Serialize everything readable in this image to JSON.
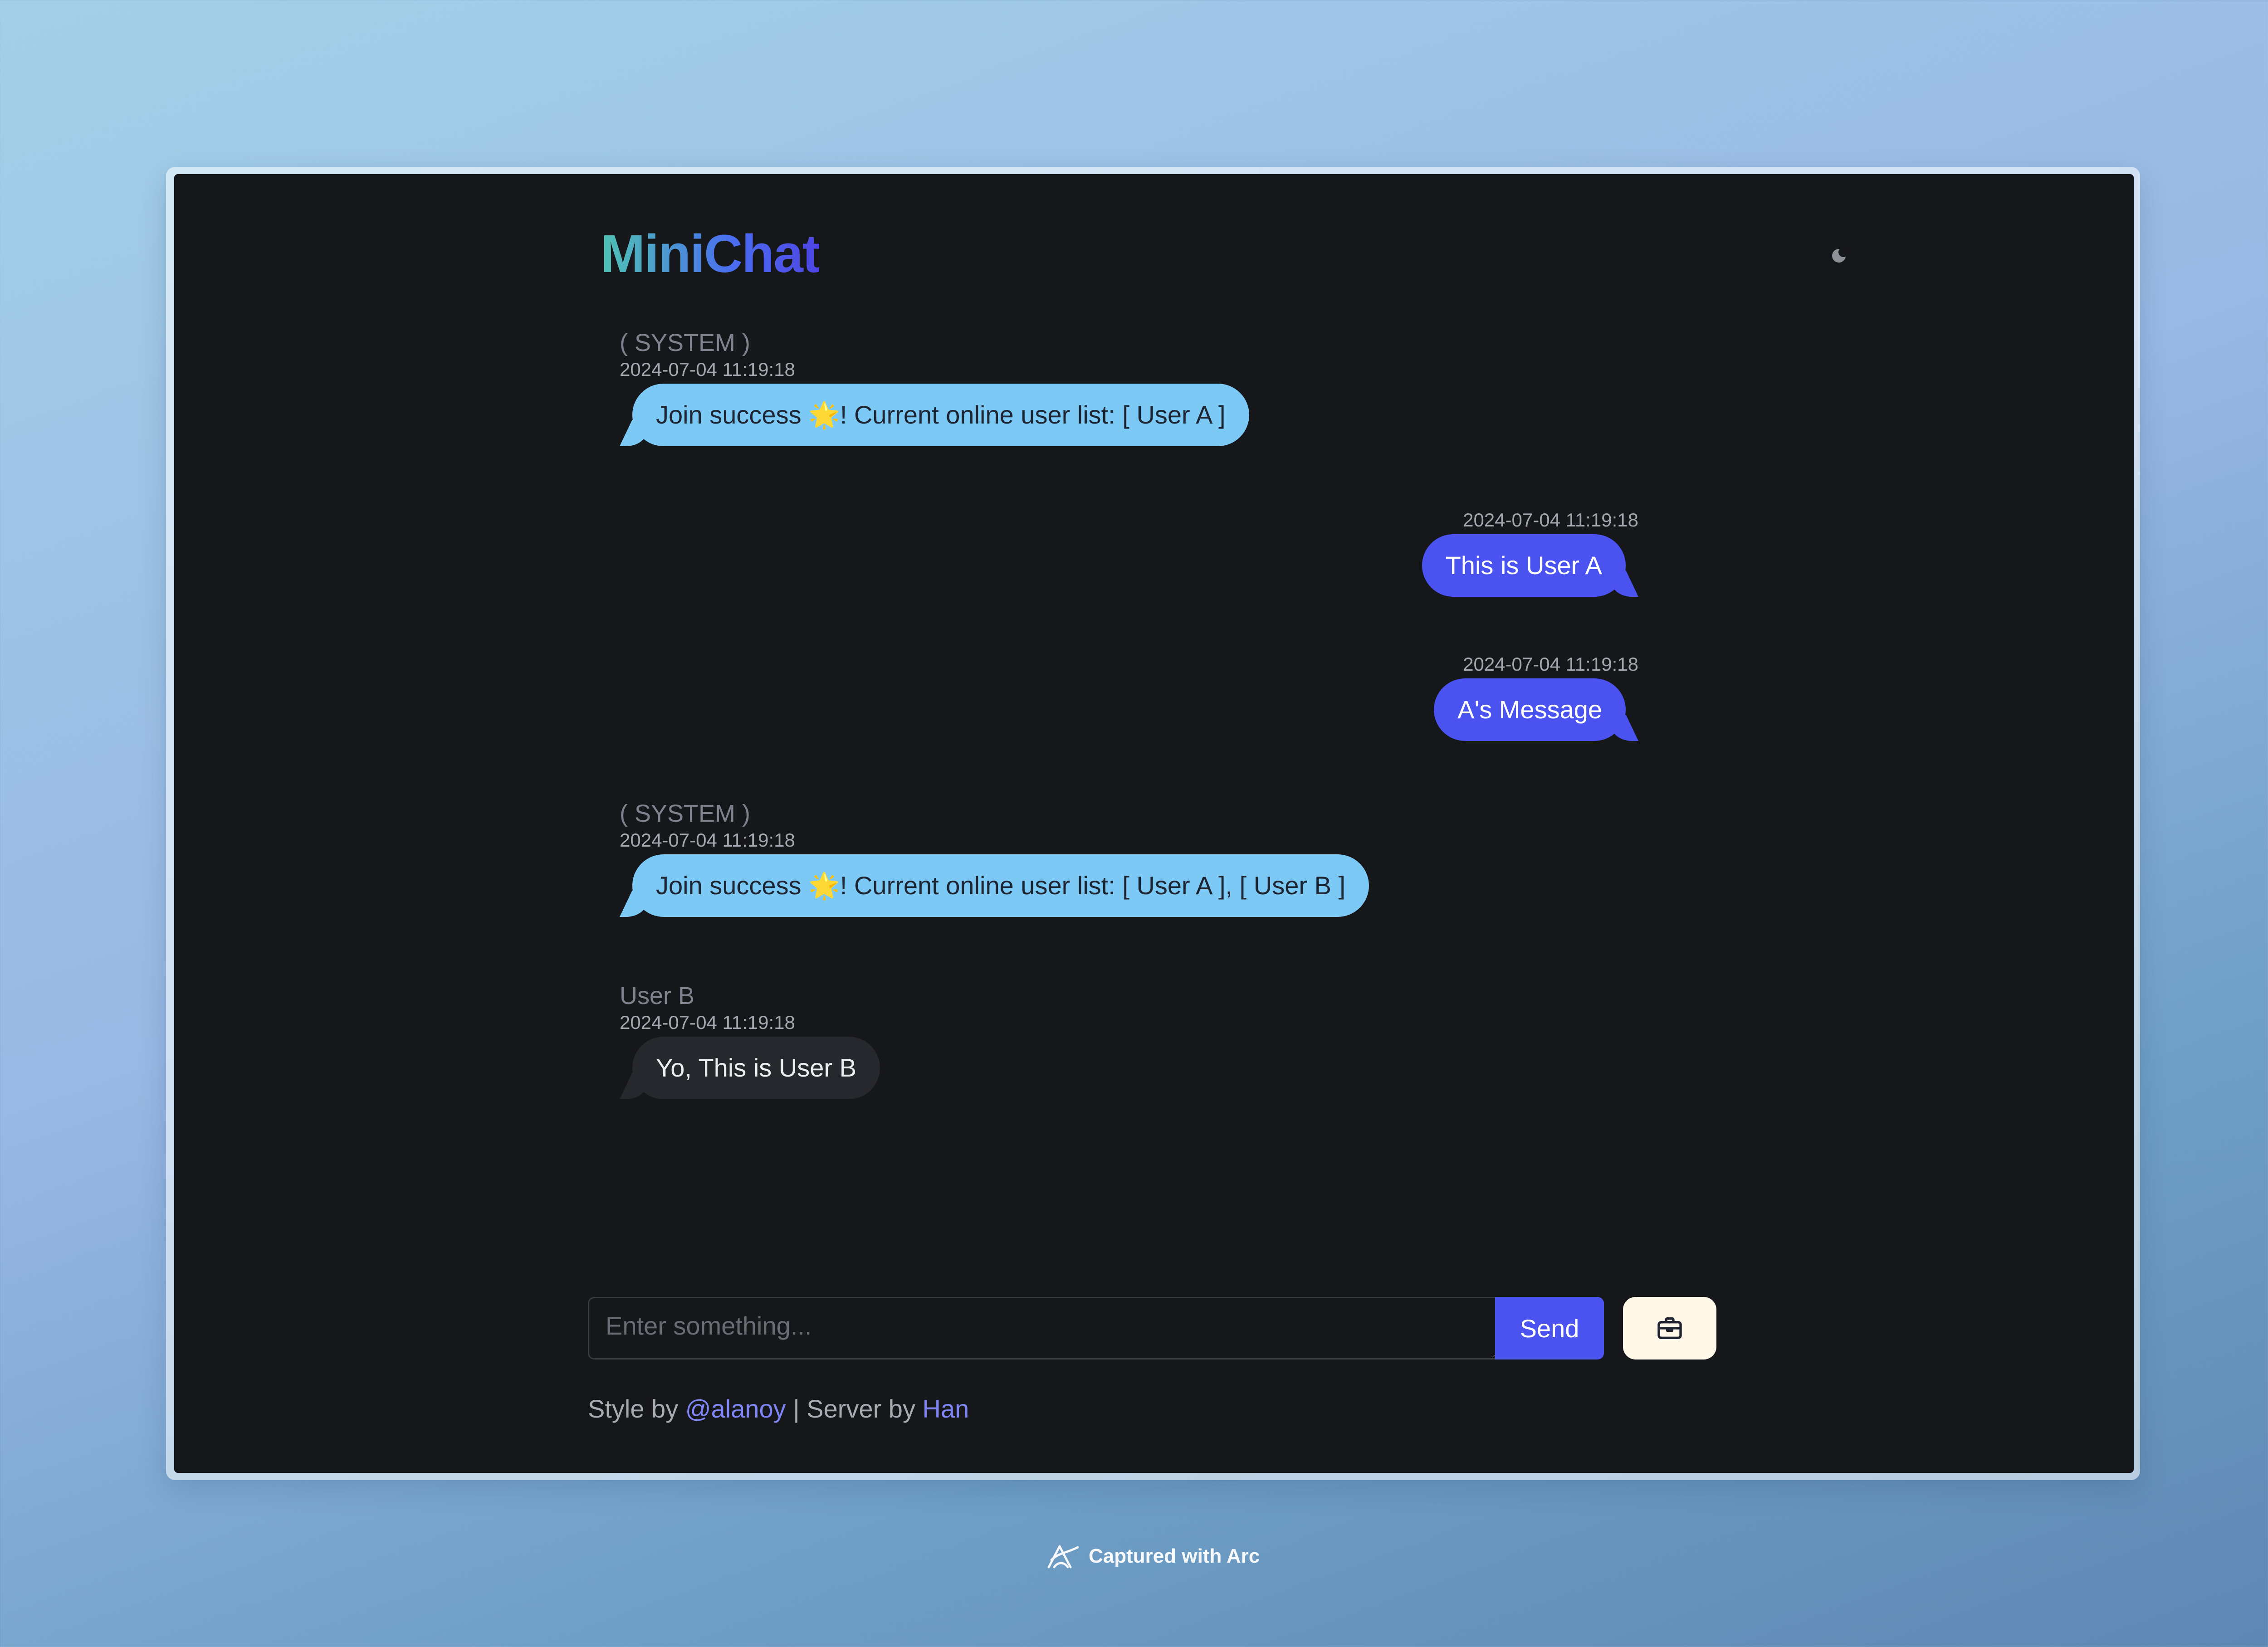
{
  "app": {
    "logo_part1": "Mini",
    "logo_part2": "Chat"
  },
  "messages": [
    {
      "sender": "( SYSTEM )",
      "time": "2024-07-04 11:19:18",
      "before_emoji": "Join success ",
      "emoji": "🌟",
      "after_emoji": "! Current online user list: [ User A ]"
    },
    {
      "time": "2024-07-04 11:19:18",
      "text": "This is User A"
    },
    {
      "time": "2024-07-04 11:19:18",
      "text": "A's Message"
    },
    {
      "sender": "( SYSTEM )",
      "time": "2024-07-04 11:19:18",
      "before_emoji": "Join success ",
      "emoji": "🌟",
      "after_emoji": "! Current online user list: [ User A ], [ User B ]"
    },
    {
      "sender": "User B",
      "time": "2024-07-04 11:19:18",
      "text": "Yo, This is User B"
    }
  ],
  "composer": {
    "placeholder": "Enter something...",
    "send_label": "Send"
  },
  "footer": {
    "style_prefix": "Style by ",
    "style_link": "@alanoy",
    "separator": " |  Server by ",
    "server_link": "Han"
  },
  "watermark": {
    "text": "Captured with Arc"
  },
  "icons": {
    "theme_toggle": "moon-icon",
    "tool_button": "toolbox-icon",
    "watermark": "arc-icon"
  },
  "colors": {
    "background": "#16171b",
    "system_bubble": "#7cc9f5",
    "self_bubble": "#4a52f0",
    "other_bubble": "#26282e",
    "link": "#7f85f5",
    "tool_button": "#fff7e8"
  }
}
